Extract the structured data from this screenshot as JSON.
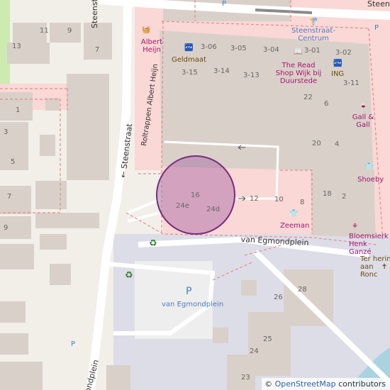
{
  "map": {
    "center_marker": {
      "type": "circle",
      "color": "#a262a2"
    },
    "colors": {
      "land": "#f2efe9",
      "building": "#d9d0c9",
      "pedestrian": "#dddde8",
      "retail_zone": "#f9d8d6",
      "parking": "#eeeeee",
      "water": "#aad3df",
      "park": "#cdebb0",
      "dashed_boundary": "#e58a8a"
    },
    "streets": [
      {
        "id": "steenstraat-top",
        "name": "Steenstraat →"
      },
      {
        "id": "steenstraat-mid",
        "name": "← Steenstraat"
      },
      {
        "id": "steenstraat-ne",
        "name": "Steen"
      },
      {
        "id": "egmondplein-street",
        "name": "van Egmondplein"
      },
      {
        "id": "egmondplein-sw",
        "name": "ondplein"
      },
      {
        "id": "roltrappen",
        "name": "Roltrappen Albert Heijn"
      }
    ],
    "pois": [
      {
        "id": "albert-heijn",
        "name": "Albert Heijn",
        "icon": "basket-icon"
      },
      {
        "id": "geldmaat",
        "name": "Geldmaat",
        "icon": "atm-icon"
      },
      {
        "id": "read-shop",
        "name": "The Read Shop Wijk bij Duurstede",
        "icon": "book-icon"
      },
      {
        "id": "ing",
        "name": "ING",
        "icon": "atm-icon"
      },
      {
        "id": "gall-gall",
        "name": "Gall & Gall",
        "icon": "bottle-icon"
      },
      {
        "id": "shoeby",
        "name": "Shoeby",
        "icon": "clothes-icon"
      },
      {
        "id": "zeeman",
        "name": "Zeeman",
        "icon": "clothes-icon"
      },
      {
        "id": "bloemsierkunst",
        "name": "Bloemsierk Henk Ganzé",
        "icon": "flower-icon"
      },
      {
        "id": "ter-herinnering",
        "name": "Ter herin aan Ronc",
        "icon": "memorial-icon"
      },
      {
        "id": "bus-stop",
        "name": "Steenstraat-Centrum",
        "icon": "bus-stop-icon"
      },
      {
        "id": "parking-egmondplein",
        "name": "van Egmondplein",
        "icon": "parking-icon"
      }
    ],
    "house_numbers": [
      "11",
      "9",
      "13",
      "7",
      "1",
      "3",
      "5",
      "7",
      "9",
      "3-06",
      "3-05",
      "3-04",
      "3-01",
      "3-02",
      "3-15",
      "3-14",
      "3-13",
      "3-11",
      "22",
      "6",
      "20",
      "4",
      "16",
      "24e",
      "24d",
      "12",
      "10",
      "8",
      "18",
      "2",
      "28",
      "26",
      "25",
      "24",
      "23"
    ],
    "symbols": {
      "parking": "P",
      "recycling": "♻"
    },
    "attribution": {
      "copyright": "©",
      "link_text": "OpenStreetMap",
      "suffix": "contributors"
    }
  }
}
